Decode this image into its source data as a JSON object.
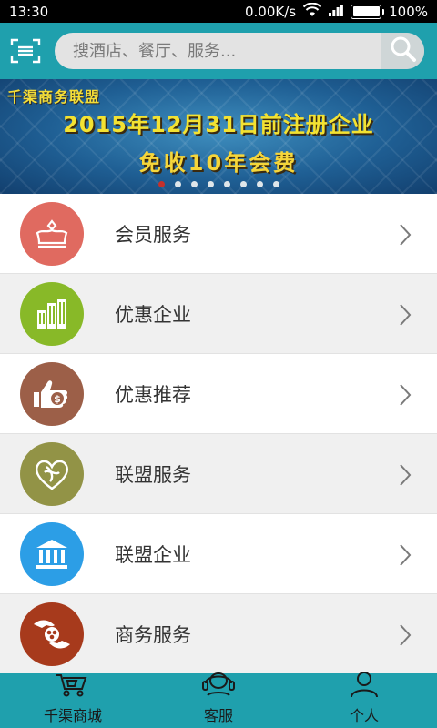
{
  "status_bar": {
    "time": "13:30",
    "speed": "0.00K/s",
    "battery": "100%",
    "battery_level": 1.0
  },
  "header": {
    "search_placeholder": "搜酒店、餐厅、服务..."
  },
  "banner": {
    "brand": "千渠商务联盟",
    "headline": "2015年12月31日前注册企业",
    "subline": "免收10年会费",
    "slide_count": 8,
    "active_slide": 1
  },
  "menu": [
    {
      "label": "会员服务",
      "icon": "crown-icon",
      "color": "#e06a60"
    },
    {
      "label": "优惠企业",
      "icon": "building-icon",
      "color": "#88b928"
    },
    {
      "label": "优惠推荐",
      "icon": "thumbs-up-money-icon",
      "color": "#9c5f48"
    },
    {
      "label": "联盟服务",
      "icon": "heart-icon",
      "color": "#929346"
    },
    {
      "label": "联盟企业",
      "icon": "bank-icon",
      "color": "#2c9ee6"
    },
    {
      "label": "商务服务",
      "icon": "hands-coin-icon",
      "color": "#a73a1c"
    }
  ],
  "bottom_nav": [
    {
      "label": "千渠商城",
      "icon": "cart-icon"
    },
    {
      "label": "客服",
      "icon": "headset-icon"
    },
    {
      "label": "个人",
      "icon": "person-icon"
    }
  ]
}
